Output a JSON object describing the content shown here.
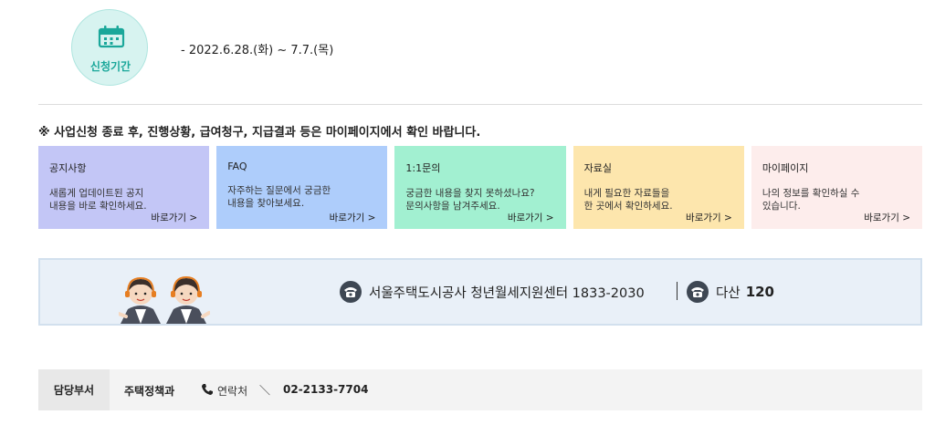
{
  "period": {
    "label": "신청기간",
    "date": "- 2022.6.28.(화) ~ 7.7.(목)",
    "icon": "calendar-icon"
  },
  "notice": "※ 사업신청 종료 후, 진행상황, 급여청구, 지급결과 등은 마이페이지에서 확인 바랍니다.",
  "cards": [
    {
      "title": "공지사항",
      "desc": "새롭게 업데이트된 공지\n내용을 바로 확인하세요.",
      "link": "바로가기 >",
      "color": "#c3c6f6"
    },
    {
      "title": "FAQ",
      "desc": "자주하는 질문에서 궁금한\n내용을 찾아보세요.",
      "link": "바로가기 >",
      "color": "#aecdfb"
    },
    {
      "title": "1:1문의",
      "desc": "궁금한 내용을 찾지 못하셨나요?\n문의사항을 남겨주세요.",
      "link": "바로가기 >",
      "color": "#a2f0d1"
    },
    {
      "title": "자료실",
      "desc": "내게 필요한 자료들을\n한 곳에서 확인하세요.",
      "link": "바로가기 >",
      "color": "#fde6ad"
    },
    {
      "title": "마이페이지",
      "desc": "나의 정보를 확인하실 수\n있습니다.",
      "link": "바로가기 >",
      "color": "#fdedec"
    }
  ],
  "callcenter": {
    "main_text": "서울주택도시공사 청년월세지원센터 1833-2030",
    "sub_label": "다산",
    "sub_number": "120",
    "icon": "phone-icon"
  },
  "department": {
    "label": "담당부서",
    "name": "주택정책과",
    "contact_label": "연락처",
    "separator": "＼",
    "number": "02-2133-7704"
  },
  "colors": {
    "accent": "#1aa79a",
    "banner_bg": "#e9f0f8",
    "dark_icon": "#3e4753"
  }
}
